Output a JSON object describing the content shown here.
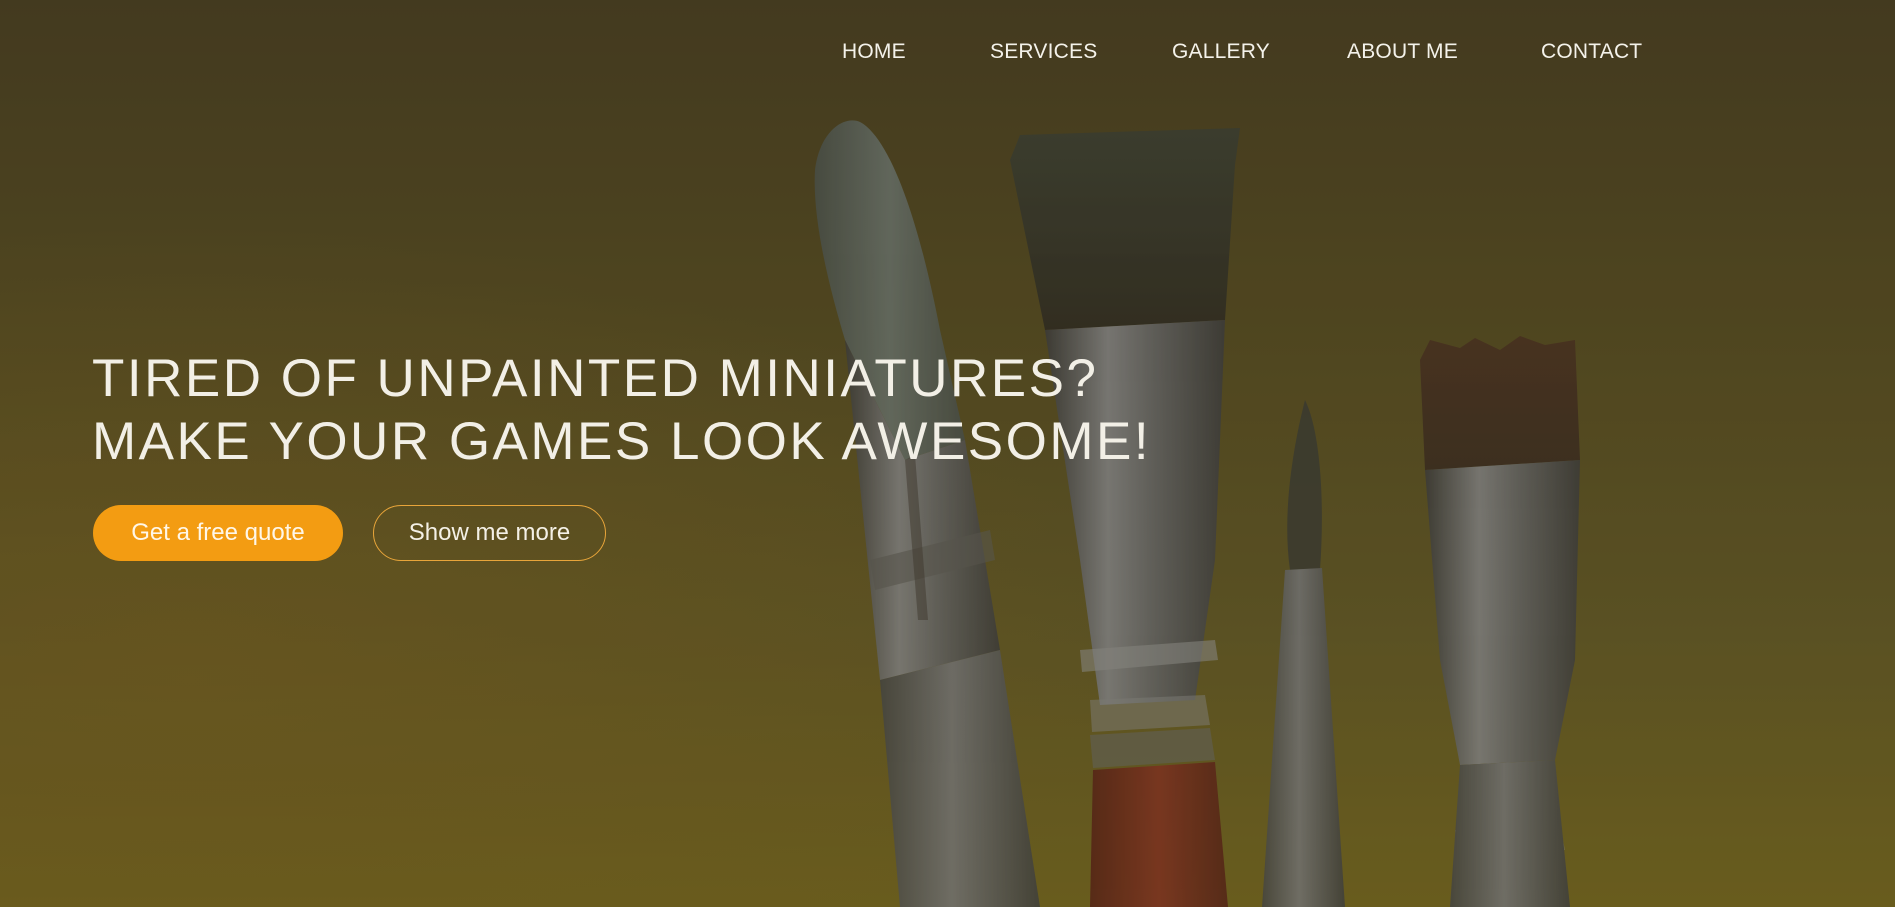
{
  "nav": {
    "items": [
      {
        "label": "HOME"
      },
      {
        "label": "SERVICES"
      },
      {
        "label": "GALLERY"
      },
      {
        "label": "ABOUT ME"
      },
      {
        "label": "CONTACT"
      }
    ]
  },
  "hero": {
    "headline_line1": "TIRED OF UNPAINTED MINIATURES?",
    "headline_line2": "MAKE YOUR GAMES LOOK AWESOME!",
    "primary_button_label": "Get a free quote",
    "secondary_button_label": "Show me more",
    "background_image": "paint-brushes photo with dark golden overlay"
  },
  "colors": {
    "accent": "#f39c12",
    "overlay": "#4f4522",
    "text": "#f2efe6"
  }
}
